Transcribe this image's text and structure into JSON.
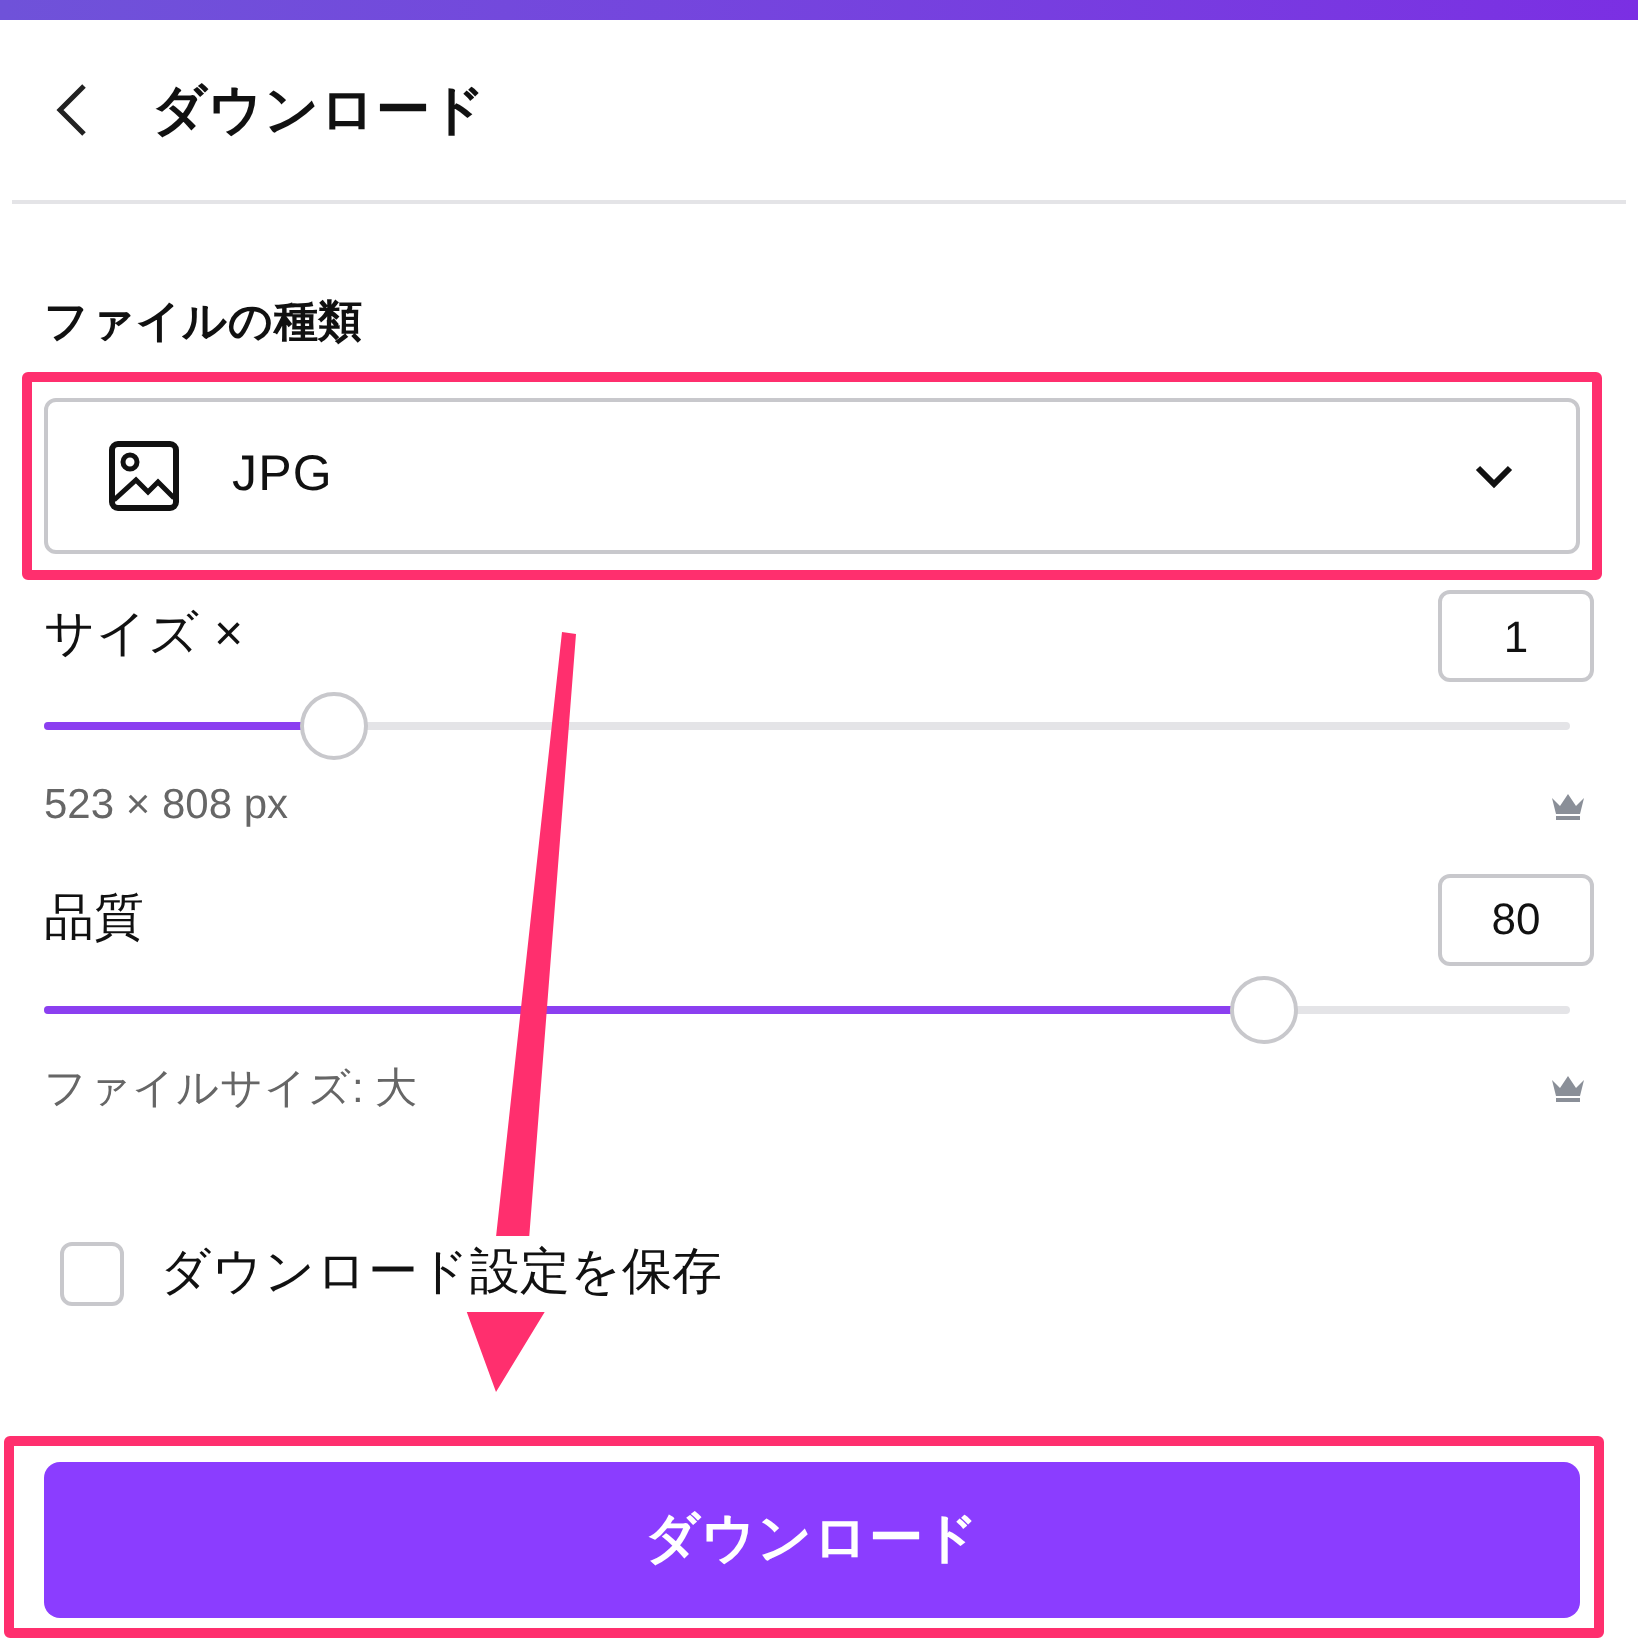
{
  "header": {
    "title": "ダウンロード"
  },
  "file_type": {
    "label": "ファイルの種類",
    "value": "JPG",
    "highlighted": true
  },
  "sliders": [
    {
      "label": "サイズ ×",
      "value": "1",
      "level": 0.19,
      "caption": "523 × 808 px"
    },
    {
      "label": "品質",
      "value": "80",
      "level": 0.8,
      "caption": "ファイルサイズ: 大"
    }
  ],
  "save_settings": {
    "label": "ダウンロード設定を保存",
    "checked": false
  },
  "download_button": {
    "label": "ダウンロード",
    "highlighted": true
  }
}
